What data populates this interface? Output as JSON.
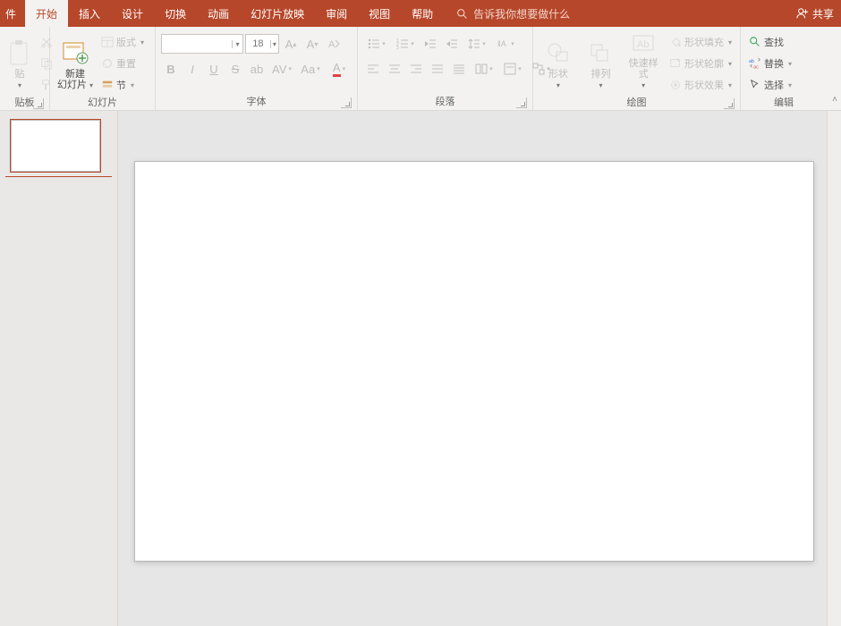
{
  "tabs": {
    "file": "件",
    "home": "开始",
    "insert": "插入",
    "design": "设计",
    "transitions": "切换",
    "animations": "动画",
    "slideshow": "幻灯片放映",
    "review": "审阅",
    "view": "视图",
    "help": "帮助"
  },
  "tellme_placeholder": "告诉我你想要做什么",
  "share_label": "共享",
  "groups": {
    "clipboard": {
      "label": "贴板",
      "paste": "贴"
    },
    "slides": {
      "label": "幻灯片",
      "new_slide": "新建\n幻灯片",
      "layout": "版式",
      "reset": "重置",
      "section": "节"
    },
    "font": {
      "label": "字体",
      "size": "18"
    },
    "paragraph": {
      "label": "段落"
    },
    "drawing": {
      "label": "绘图",
      "shapes": "形状",
      "arrange": "排列",
      "quickstyles": "快速样式",
      "shape_fill": "形状填充",
      "shape_outline": "形状轮廓",
      "shape_effects": "形状效果"
    },
    "editing": {
      "label": "编辑",
      "find": "查找",
      "replace": "替换",
      "select": "选择"
    }
  }
}
